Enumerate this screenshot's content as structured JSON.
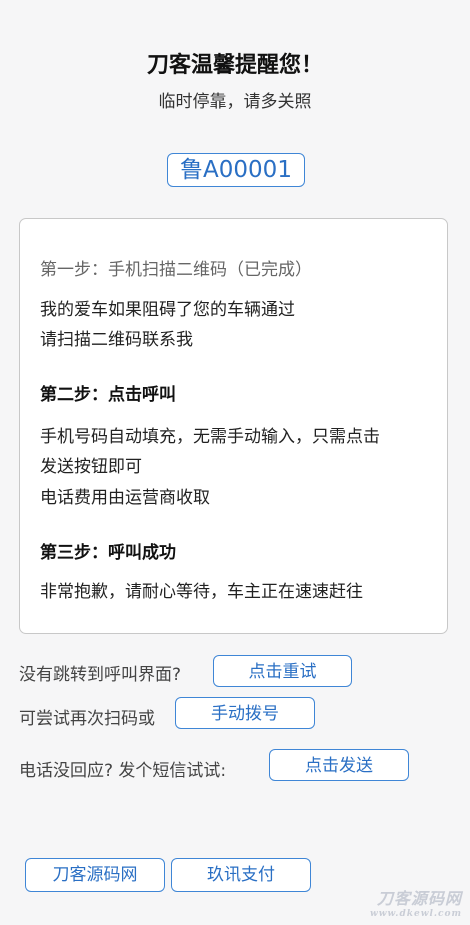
{
  "header": {
    "title": "刀客温馨提醒您！",
    "subtitle": "临时停靠，请多关照"
  },
  "plate": {
    "number": "鲁A00001"
  },
  "steps": {
    "step1_title": "第一步：手机扫描二维码（已完成）",
    "step1_line1": "我的爱车如果阻碍了您的车辆通过",
    "step1_line2": "请扫描二维码联系我",
    "step2_title": "第二步：点击呼叫",
    "step2_line1": "手机号码自动填充，无需手动输入，只需点击",
    "step2_line2": "发送按钮即可",
    "step2_line3": "电话费用由运营商收取",
    "step3_title": "第三步：呼叫成功",
    "step3_line1": "非常抱歉，请耐心等待，车主正在速速赶往"
  },
  "actions": {
    "retry_prompt": "没有跳转到呼叫界面?",
    "retry_button": "点击重试",
    "manual_prompt": "可尝试再次扫码或",
    "manual_button": "手动拨号",
    "sms_prompt": "电话没回应? 发个短信试试:",
    "sms_button": "点击发送"
  },
  "footer": {
    "source_button": "刀客源码网",
    "pay_button": "玖讯支付"
  },
  "watermark": {
    "main": "刀客源码网",
    "sub": "www.dkewl.com"
  },
  "colors": {
    "accent": "#3f86d6",
    "background": "#f6f6f7",
    "card": "#ffffff"
  }
}
